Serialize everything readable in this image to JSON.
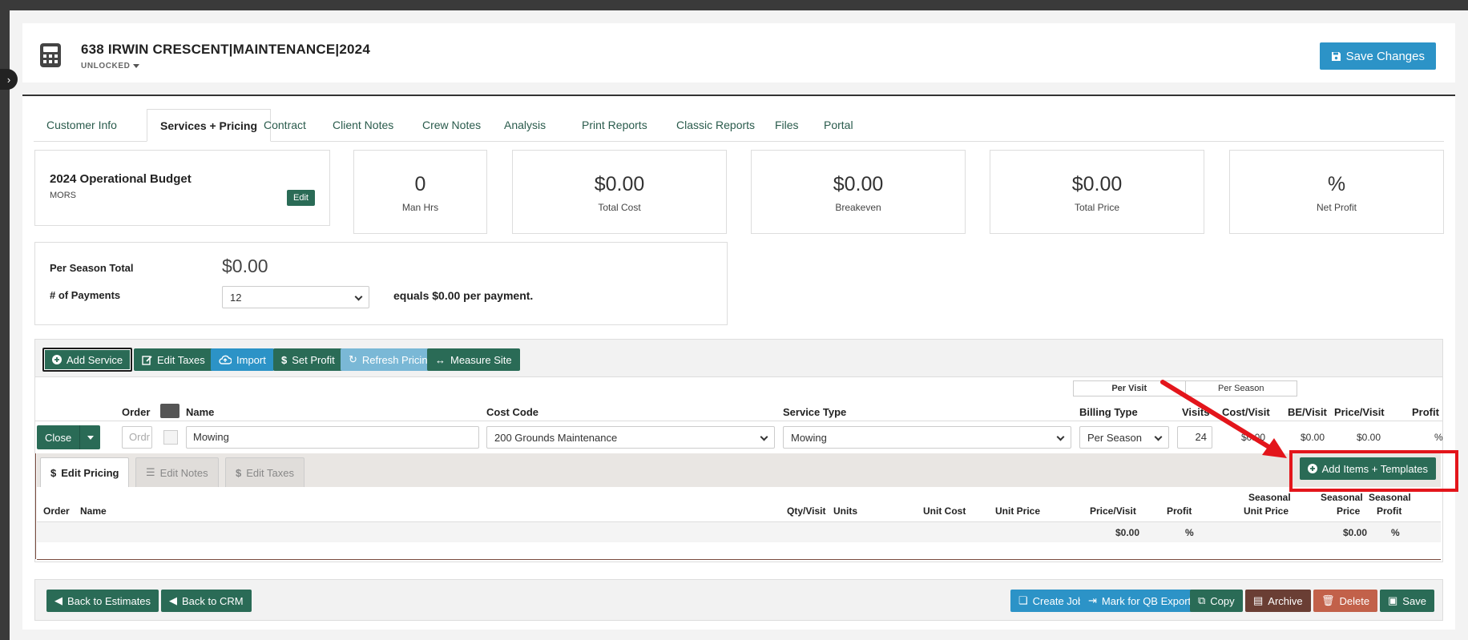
{
  "header": {
    "title": "638 IRWIN CRESCENT|MAINTENANCE|2024",
    "status": "UNLOCKED",
    "save_changes": "Save Changes"
  },
  "tabs": [
    "Customer Info",
    "Services + Pricing",
    "Contract",
    "Client Notes",
    "Crew Notes",
    "Analysis",
    "Print Reports",
    "Classic Reports",
    "Files",
    "Portal"
  ],
  "active_tab": "Services + Pricing",
  "budget": {
    "title": "2024 Operational Budget",
    "subtitle": "MORS",
    "edit": "Edit"
  },
  "stats": [
    {
      "value": "0",
      "label": "Man Hrs"
    },
    {
      "value": "$0.00",
      "label": "Total Cost"
    },
    {
      "value": "$0.00",
      "label": "Breakeven"
    },
    {
      "value": "$0.00",
      "label": "Total Price"
    },
    {
      "value": "%",
      "label": "Net Profit"
    }
  ],
  "season": {
    "total_label": "Per Season Total",
    "total_value": "$0.00",
    "payments_label": "# of Payments",
    "payments_value": "12",
    "equals_text": "equals $0.00 per payment."
  },
  "toolbar": {
    "add_service": "Add Service",
    "edit_taxes": "Edit Taxes",
    "import": "Import",
    "set_profit": "Set Profit",
    "refresh_pricing": "Refresh Pricing",
    "measure_site": "Measure Site"
  },
  "toggle": {
    "per_visit": "Per Visit",
    "per_season": "Per Season"
  },
  "columns": {
    "order": "Order",
    "name": "Name",
    "cost_code": "Cost Code",
    "service_type": "Service Type",
    "billing_type": "Billing Type",
    "visits": "Visits",
    "cost_visit": "Cost/Visit",
    "be_visit": "BE/Visit",
    "price_visit": "Price/Visit",
    "profit": "Profit"
  },
  "service_row": {
    "close": "Close",
    "order_placeholder": "Ordr",
    "name": "Mowing",
    "cost_code": "200 Grounds Maintenance",
    "service_type": "Mowing",
    "billing_type": "Per Season",
    "visits": "24",
    "cost_visit": "$0.00",
    "be_visit": "$0.00",
    "price_visit": "$0.00",
    "profit": "%"
  },
  "sub_tabs": {
    "edit_pricing": "Edit Pricing",
    "edit_notes": "Edit Notes",
    "edit_taxes": "Edit Taxes"
  },
  "add_items": "Add Items + Templates",
  "item_columns": {
    "order": "Order",
    "name": "Name",
    "qty_visit": "Qty/Visit",
    "units": "Units",
    "unit_cost": "Unit Cost",
    "unit_price": "Unit Price",
    "price_visit": "Price/Visit",
    "profit": "Profit",
    "seasonal": "Seasonal",
    "unit_price_2": "Unit Price",
    "price": "Price",
    "profit_2": "Profit"
  },
  "item_totals": {
    "price_visit": "$0.00",
    "profit": "%",
    "seasonal_price": "$0.00",
    "seasonal_profit": "%"
  },
  "footer": {
    "back_estimates": "Back to Estimates",
    "back_crm": "Back to CRM",
    "create_job": "Create Job",
    "mark_qb": "Mark for QB Export",
    "copy": "Copy",
    "archive": "Archive",
    "delete": "Delete",
    "save": "Save"
  },
  "colors": {
    "green": "#2a6b56",
    "blue": "#2c93c7",
    "brown": "#6a3e34",
    "red": "#c2614a",
    "annotation": "#e3151b"
  }
}
